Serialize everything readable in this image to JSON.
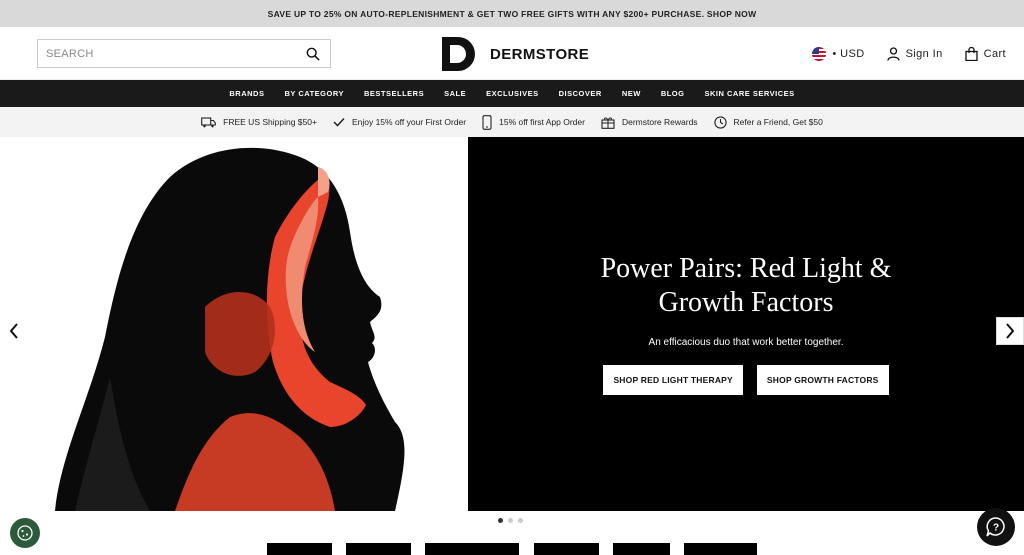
{
  "promo_banner": {
    "text": "SAVE UP TO 25% ON AUTO-REPLENISHMENT & GET TWO FREE GIFTS WITH ANY $200+ PURCHASE. SHOP NOW"
  },
  "header": {
    "search_placeholder": "SEARCH",
    "logo_text": "DERMSTORE",
    "currency": "• USD",
    "sign_in": "Sign In",
    "cart": "Cart"
  },
  "nav": {
    "items": [
      {
        "label": "BRANDS"
      },
      {
        "label": "BY CATEGORY"
      },
      {
        "label": "BESTSELLERS"
      },
      {
        "label": "SALE"
      },
      {
        "label": "EXCLUSIVES"
      },
      {
        "label": "DISCOVER"
      },
      {
        "label": "NEW"
      },
      {
        "label": "BLOG"
      },
      {
        "label": "SKIN CARE SERVICES"
      }
    ]
  },
  "benefits": {
    "items": [
      {
        "icon": "truck-icon",
        "label": "FREE US Shipping $50+"
      },
      {
        "icon": "checkmark-icon",
        "label": "Enjoy 15% off your First Order"
      },
      {
        "icon": "phone-icon",
        "label": "15% off first App Order"
      },
      {
        "icon": "gift-icon",
        "label": "Dermstore Rewards"
      },
      {
        "icon": "refer-icon",
        "label": "Refer a Friend, Get $50"
      }
    ]
  },
  "hero": {
    "headline_line1": "Power Pairs: Red Light &",
    "headline_line2": "Growth Factors",
    "subline": "An efficacious duo that work better together.",
    "cta_primary": "SHOP RED LIGHT THERAPY",
    "cta_secondary": "SHOP GROWTH FACTORS",
    "slides_total": 3,
    "active_slide": 1
  },
  "colors": {
    "nav_bg": "#1a1a1a",
    "promo_bg": "#d9d9d9",
    "accent_red": "#e8452c",
    "cookie_bg": "#2c5a3c"
  }
}
